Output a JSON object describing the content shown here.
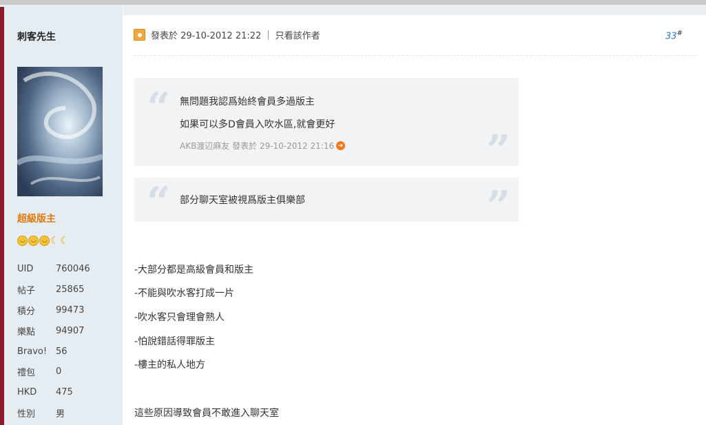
{
  "author": {
    "name": "刺客先生",
    "role": "超級版主",
    "avatar_text": "刺客先生",
    "stats": [
      {
        "label": "UID",
        "value": "760046"
      },
      {
        "label": "帖子",
        "value": "25865"
      },
      {
        "label": "積分",
        "value": "99473"
      },
      {
        "label": "樂點",
        "value": "94907"
      },
      {
        "label": "Bravo!",
        "value": "56"
      },
      {
        "label": "禮包",
        "value": "0"
      },
      {
        "label": "HKD",
        "value": "475"
      },
      {
        "label": "性別",
        "value": "男"
      }
    ],
    "rank_icons": [
      "smiley-icon",
      "smiley-icon",
      "smiley-icon",
      "moon-icon",
      "moon-icon"
    ]
  },
  "post": {
    "posted_at": "發表於 29-10-2012 21:22",
    "only_author": "只看該作者",
    "floor": "33",
    "floor_suffix": "#",
    "quote1": {
      "line1": "無問題我認爲始終會員多過版主",
      "line2": "如果可以多D會員入吹水區,就會更好",
      "meta": "AKB渡辺麻友 發表於 29-10-2012 21:16"
    },
    "quote2": {
      "line1": "部分聊天室被視爲版主俱樂部"
    },
    "body": [
      "-大部分都是高級會員和版主",
      "-不能與吹水客打成一片",
      "-吹水客只會理會熟人",
      "-怕說錯話得罪版主",
      "-樓主的私人地方",
      "這些原因導致會員不敢進入聊天室"
    ]
  },
  "colors": {
    "sidebar_bg": "#e5edf3",
    "accent": "#8b1a2a",
    "role": "#e07a10",
    "floor_link": "#2b7ab8",
    "quote_bg": "#f2f3f5"
  }
}
